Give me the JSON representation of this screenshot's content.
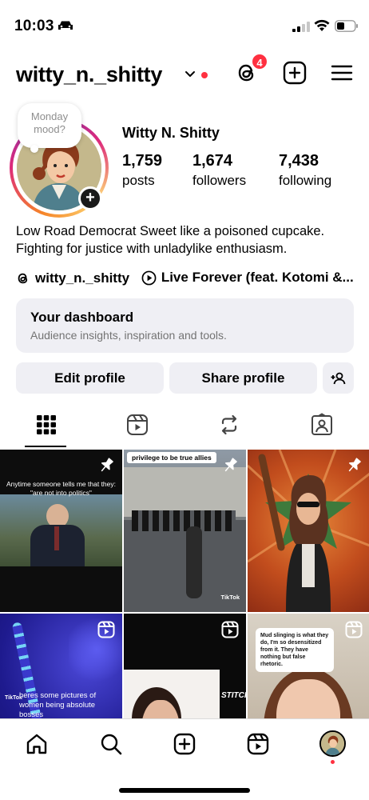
{
  "status_bar": {
    "time": "10:03"
  },
  "header": {
    "username": "witty_n._shitty",
    "threads_badge": "4",
    "icons": [
      "threads-icon",
      "create-icon",
      "menu-icon"
    ]
  },
  "profile": {
    "note": "Monday mood?",
    "display_name": "Witty N. Shitty",
    "stats": [
      {
        "num": "1,759",
        "label": "posts"
      },
      {
        "num": "1,674",
        "label": "followers"
      },
      {
        "num": "7,438",
        "label": "following"
      }
    ],
    "bio": "Low Road Democrat Sweet like a poisoned cupcake. Fighting for justice with unladylike enthusiasm.",
    "threads_link": "witty_n._shitty",
    "music_link": "Live Forever (feat. Kotomi &..."
  },
  "dashboard": {
    "title": "Your dashboard",
    "subtitle": "Audience insights, inspiration and tools."
  },
  "buttons": {
    "edit": "Edit profile",
    "share": "Share profile"
  },
  "posts": [
    {
      "caption": "Anytime someone tells me that they: \"are not into politics\"",
      "badge": "pin"
    },
    {
      "caption": "privilege to be true allies",
      "badge": "pin",
      "watermark": "TikTok"
    },
    {
      "caption": "",
      "badge": "pin"
    },
    {
      "caption": "heres some pictures of women being absolute bosses",
      "badge": "reel",
      "watermark": "TikTok"
    },
    {
      "caption": "STITCH",
      "badge": "reel"
    },
    {
      "caption": "Mud slinging is what they do, I'm so desensitized from it. They have nothing but false rhetoric.",
      "badge": "reel"
    }
  ],
  "colors": {
    "accent_red": "#ff3040",
    "button_bg": "#efeff4",
    "muted_text": "#737373"
  }
}
